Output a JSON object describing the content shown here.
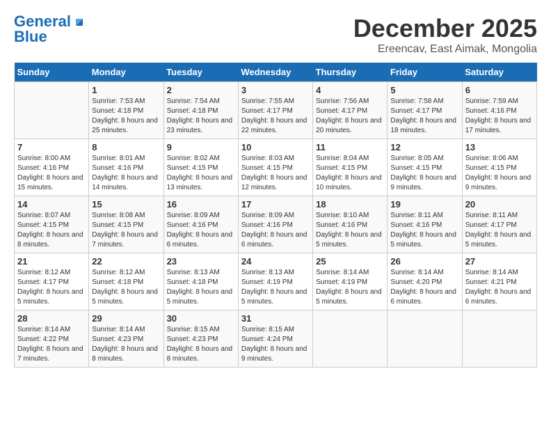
{
  "header": {
    "logo_line1": "General",
    "logo_line2": "Blue",
    "title": "December 2025",
    "subtitle": "Ereencav, East Aimak, Mongolia"
  },
  "weekdays": [
    "Sunday",
    "Monday",
    "Tuesday",
    "Wednesday",
    "Thursday",
    "Friday",
    "Saturday"
  ],
  "weeks": [
    [
      {
        "day": "",
        "sunrise": "",
        "sunset": "",
        "daylight": ""
      },
      {
        "day": "1",
        "sunrise": "Sunrise: 7:53 AM",
        "sunset": "Sunset: 4:18 PM",
        "daylight": "Daylight: 8 hours and 25 minutes."
      },
      {
        "day": "2",
        "sunrise": "Sunrise: 7:54 AM",
        "sunset": "Sunset: 4:18 PM",
        "daylight": "Daylight: 8 hours and 23 minutes."
      },
      {
        "day": "3",
        "sunrise": "Sunrise: 7:55 AM",
        "sunset": "Sunset: 4:17 PM",
        "daylight": "Daylight: 8 hours and 22 minutes."
      },
      {
        "day": "4",
        "sunrise": "Sunrise: 7:56 AM",
        "sunset": "Sunset: 4:17 PM",
        "daylight": "Daylight: 8 hours and 20 minutes."
      },
      {
        "day": "5",
        "sunrise": "Sunrise: 7:58 AM",
        "sunset": "Sunset: 4:17 PM",
        "daylight": "Daylight: 8 hours and 18 minutes."
      },
      {
        "day": "6",
        "sunrise": "Sunrise: 7:59 AM",
        "sunset": "Sunset: 4:16 PM",
        "daylight": "Daylight: 8 hours and 17 minutes."
      }
    ],
    [
      {
        "day": "7",
        "sunrise": "Sunrise: 8:00 AM",
        "sunset": "Sunset: 4:16 PM",
        "daylight": "Daylight: 8 hours and 15 minutes."
      },
      {
        "day": "8",
        "sunrise": "Sunrise: 8:01 AM",
        "sunset": "Sunset: 4:16 PM",
        "daylight": "Daylight: 8 hours and 14 minutes."
      },
      {
        "day": "9",
        "sunrise": "Sunrise: 8:02 AM",
        "sunset": "Sunset: 4:15 PM",
        "daylight": "Daylight: 8 hours and 13 minutes."
      },
      {
        "day": "10",
        "sunrise": "Sunrise: 8:03 AM",
        "sunset": "Sunset: 4:15 PM",
        "daylight": "Daylight: 8 hours and 12 minutes."
      },
      {
        "day": "11",
        "sunrise": "Sunrise: 8:04 AM",
        "sunset": "Sunset: 4:15 PM",
        "daylight": "Daylight: 8 hours and 10 minutes."
      },
      {
        "day": "12",
        "sunrise": "Sunrise: 8:05 AM",
        "sunset": "Sunset: 4:15 PM",
        "daylight": "Daylight: 8 hours and 9 minutes."
      },
      {
        "day": "13",
        "sunrise": "Sunrise: 8:06 AM",
        "sunset": "Sunset: 4:15 PM",
        "daylight": "Daylight: 8 hours and 9 minutes."
      }
    ],
    [
      {
        "day": "14",
        "sunrise": "Sunrise: 8:07 AM",
        "sunset": "Sunset: 4:15 PM",
        "daylight": "Daylight: 8 hours and 8 minutes."
      },
      {
        "day": "15",
        "sunrise": "Sunrise: 8:08 AM",
        "sunset": "Sunset: 4:15 PM",
        "daylight": "Daylight: 8 hours and 7 minutes."
      },
      {
        "day": "16",
        "sunrise": "Sunrise: 8:09 AM",
        "sunset": "Sunset: 4:16 PM",
        "daylight": "Daylight: 8 hours and 6 minutes."
      },
      {
        "day": "17",
        "sunrise": "Sunrise: 8:09 AM",
        "sunset": "Sunset: 4:16 PM",
        "daylight": "Daylight: 8 hours and 6 minutes."
      },
      {
        "day": "18",
        "sunrise": "Sunrise: 8:10 AM",
        "sunset": "Sunset: 4:16 PM",
        "daylight": "Daylight: 8 hours and 5 minutes."
      },
      {
        "day": "19",
        "sunrise": "Sunrise: 8:11 AM",
        "sunset": "Sunset: 4:16 PM",
        "daylight": "Daylight: 8 hours and 5 minutes."
      },
      {
        "day": "20",
        "sunrise": "Sunrise: 8:11 AM",
        "sunset": "Sunset: 4:17 PM",
        "daylight": "Daylight: 8 hours and 5 minutes."
      }
    ],
    [
      {
        "day": "21",
        "sunrise": "Sunrise: 8:12 AM",
        "sunset": "Sunset: 4:17 PM",
        "daylight": "Daylight: 8 hours and 5 minutes."
      },
      {
        "day": "22",
        "sunrise": "Sunrise: 8:12 AM",
        "sunset": "Sunset: 4:18 PM",
        "daylight": "Daylight: 8 hours and 5 minutes."
      },
      {
        "day": "23",
        "sunrise": "Sunrise: 8:13 AM",
        "sunset": "Sunset: 4:18 PM",
        "daylight": "Daylight: 8 hours and 5 minutes."
      },
      {
        "day": "24",
        "sunrise": "Sunrise: 8:13 AM",
        "sunset": "Sunset: 4:19 PM",
        "daylight": "Daylight: 8 hours and 5 minutes."
      },
      {
        "day": "25",
        "sunrise": "Sunrise: 8:14 AM",
        "sunset": "Sunset: 4:19 PM",
        "daylight": "Daylight: 8 hours and 5 minutes."
      },
      {
        "day": "26",
        "sunrise": "Sunrise: 8:14 AM",
        "sunset": "Sunset: 4:20 PM",
        "daylight": "Daylight: 8 hours and 6 minutes."
      },
      {
        "day": "27",
        "sunrise": "Sunrise: 8:14 AM",
        "sunset": "Sunset: 4:21 PM",
        "daylight": "Daylight: 8 hours and 6 minutes."
      }
    ],
    [
      {
        "day": "28",
        "sunrise": "Sunrise: 8:14 AM",
        "sunset": "Sunset: 4:22 PM",
        "daylight": "Daylight: 8 hours and 7 minutes."
      },
      {
        "day": "29",
        "sunrise": "Sunrise: 8:14 AM",
        "sunset": "Sunset: 4:23 PM",
        "daylight": "Daylight: 8 hours and 8 minutes."
      },
      {
        "day": "30",
        "sunrise": "Sunrise: 8:15 AM",
        "sunset": "Sunset: 4:23 PM",
        "daylight": "Daylight: 8 hours and 8 minutes."
      },
      {
        "day": "31",
        "sunrise": "Sunrise: 8:15 AM",
        "sunset": "Sunset: 4:24 PM",
        "daylight": "Daylight: 8 hours and 9 minutes."
      },
      {
        "day": "",
        "sunrise": "",
        "sunset": "",
        "daylight": ""
      },
      {
        "day": "",
        "sunrise": "",
        "sunset": "",
        "daylight": ""
      },
      {
        "day": "",
        "sunrise": "",
        "sunset": "",
        "daylight": ""
      }
    ]
  ]
}
